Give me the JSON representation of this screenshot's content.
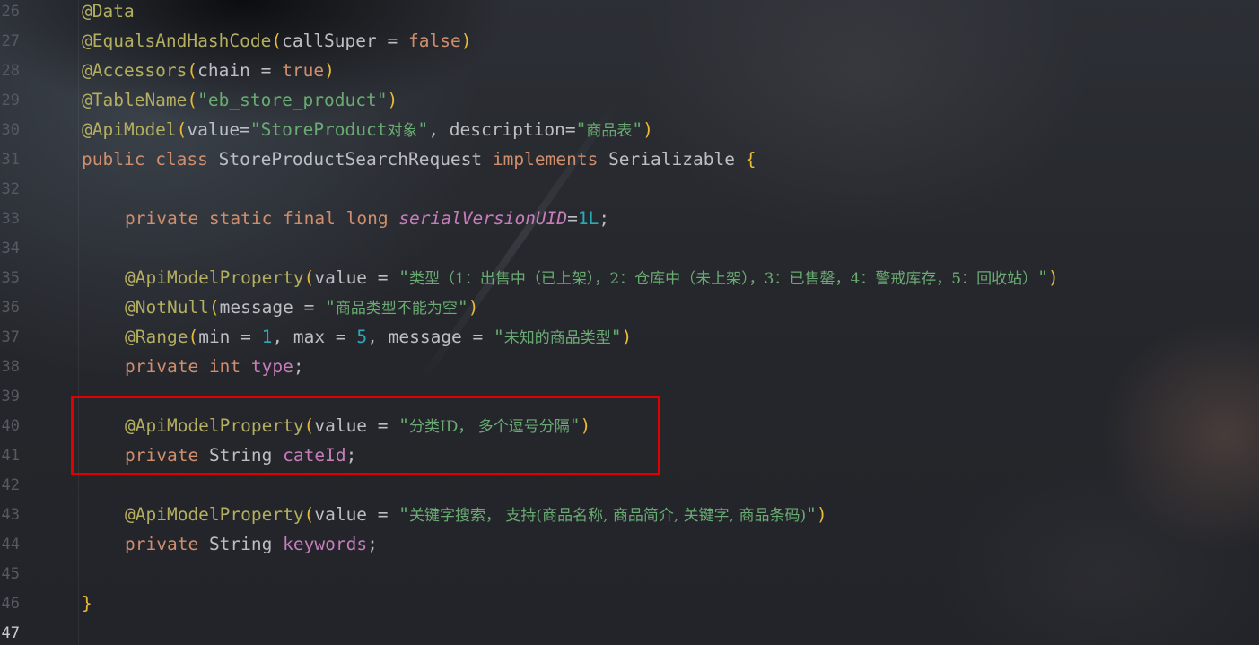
{
  "editor": {
    "lines": [
      {
        "num": "26"
      },
      {
        "num": "27"
      },
      {
        "num": "28"
      },
      {
        "num": "29"
      },
      {
        "num": "30"
      },
      {
        "num": "31"
      },
      {
        "num": "32"
      },
      {
        "num": "33"
      },
      {
        "num": "34"
      },
      {
        "num": "35"
      },
      {
        "num": "36"
      },
      {
        "num": "37"
      },
      {
        "num": "38"
      },
      {
        "num": "39"
      },
      {
        "num": "40"
      },
      {
        "num": "41"
      },
      {
        "num": "42"
      },
      {
        "num": "43"
      },
      {
        "num": "44"
      },
      {
        "num": "45"
      },
      {
        "num": "46"
      },
      {
        "num": "47"
      }
    ],
    "tokens": {
      "at_data": "@Data",
      "at_equals": "@EqualsAndHashCode",
      "lp": "(",
      "rp": ")",
      "callSuper": "callSuper",
      "eq": " = ",
      "false": "false",
      "at_accessors": "@Accessors",
      "chain": "chain",
      "true": "true",
      "at_tablename": "@TableName",
      "tablename_val": "\"eb_store_product\"",
      "at_apimodel": "@ApiModel",
      "value_kw": "value",
      "eq_tight": "=",
      "apimodel_value_a": "\"StoreProduct",
      "apimodel_value_cn": "对象",
      "quote": "\"",
      "comma": ", ",
      "description": "description",
      "apimodel_desc_cn": "商品表",
      "public": "public",
      "class": "class",
      "class_name": "StoreProductSearchRequest",
      "implements": "implements",
      "serializable": "Serializable",
      "lbrace": "{",
      "rbrace": "}",
      "private": "private",
      "static": "static",
      "final": "final",
      "long": "long",
      "serial_field": "serialVersionUID",
      "serial_num": "1L",
      "semi": ";",
      "at_apimodelprop": "@ApiModelProperty",
      "type_desc_cn": "类型（1：出售中（已上架），2：仓库中（未上架），3：已售罄，4：警戒库存，5：回收站）",
      "at_notnull": "@NotNull",
      "message": "message",
      "notnull_msg_cn": "商品类型不能为空",
      "at_range": "@Range",
      "min": "min",
      "max": "max",
      "one": "1",
      "five": "5",
      "range_msg_cn": "未知的商品类型",
      "int": "int",
      "type_field": "type",
      "cateid_desc_cn": "分类ID， 多个逗号分隔",
      "string_type": "String",
      "cateid_field": "cateId",
      "keywords_desc_cn": "关键字搜索， 支持(商品名称, 商品简介, 关键字, 商品条码)",
      "keywords_field": "keywords"
    }
  },
  "colors": {
    "annotation": "#b3ae60",
    "keyword": "#cf8e6d",
    "string": "#6aab73",
    "number": "#2aacb8",
    "field": "#c77dbb",
    "bracket": "#e8ba36",
    "highlight_box": "#e00000"
  }
}
